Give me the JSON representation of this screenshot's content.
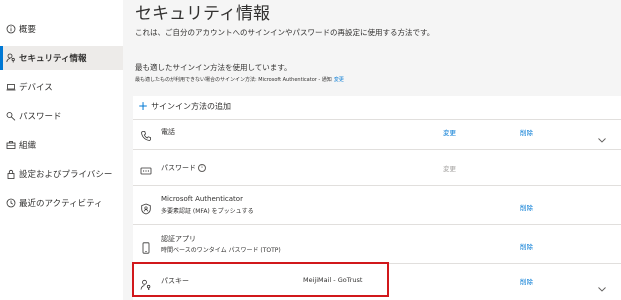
{
  "sidebar": {
    "items": [
      {
        "label": "概要",
        "icon": "info-icon"
      },
      {
        "label": "セキュリティ情報",
        "icon": "person-key-icon",
        "active": true
      },
      {
        "label": "デバイス",
        "icon": "laptop-icon"
      },
      {
        "label": "パスワード",
        "icon": "key-icon"
      },
      {
        "label": "組織",
        "icon": "briefcase-icon"
      },
      {
        "label": "設定およびプライバシー",
        "icon": "lock-icon"
      },
      {
        "label": "最近のアクティビティ",
        "icon": "history-icon"
      }
    ]
  },
  "main": {
    "title": "セキュリティ情報",
    "subtitle": "これは、ご自分のアカウントへのサインインやパスワードの再設定に使用する方法です。",
    "default_heading": "最も適したサインイン方法を使用しています。",
    "default_detail": "最も適したものが利用できない場合のサインイン方法: Microsoft Authenticator - 通知",
    "default_change_link": "変更",
    "add_method_label": "サインイン方法の追加",
    "methods": [
      {
        "name": "電話",
        "desc": "",
        "value": "",
        "change": "変更",
        "delete": "削除",
        "chevron": true,
        "icon": "phone-icon"
      },
      {
        "name": "パスワード",
        "desc": "",
        "value": "",
        "change": "変更",
        "change_disabled": true,
        "delete": "",
        "chevron": false,
        "info": true,
        "icon": "password-dots-icon"
      },
      {
        "name": "Microsoft Authenticator",
        "desc": "多要素認証 (MFA) をプッシュする",
        "value": "",
        "change": "",
        "delete": "削除",
        "chevron": false,
        "icon": "authenticator-icon"
      },
      {
        "name": "認証アプリ",
        "desc": "時間ベースのワンタイム パスワード (TOTP)",
        "value": "",
        "change": "",
        "delete": "削除",
        "chevron": false,
        "icon": "mobile-app-icon"
      },
      {
        "name": "パスキー",
        "desc": "",
        "value": "MeijiMail - GoTrust",
        "change": "",
        "delete": "削除",
        "chevron": true,
        "icon": "passkey-icon"
      }
    ]
  },
  "colors": {
    "accent": "#0078d4",
    "highlight_box": "#d1181b",
    "background": "#f5f5f5"
  }
}
